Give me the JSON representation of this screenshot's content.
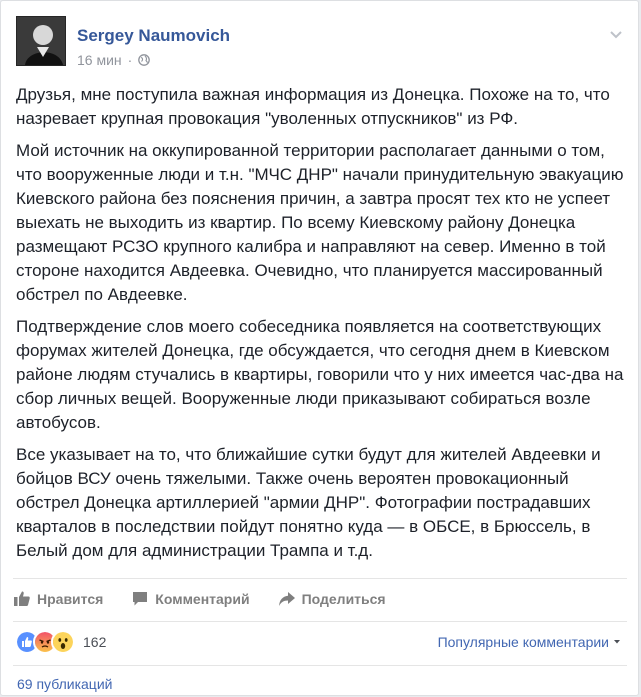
{
  "post": {
    "author": "Sergey Naumovich",
    "time": "16 мин",
    "separator": "·",
    "paragraphs": [
      "Друзья, мне поступила важная информация из Донецка. Похоже на то, что назревает крупная провокация \"уволенных отпускников\" из РФ.",
      "Мой источник на оккупированной территории располагает данными о том, что вооруженные люди и т.н. \"МЧС ДНР\" начали принудительную эвакуацию Киевского района без пояснения причин, а завтра просят тех кто не успеет выехать не выходить из квартир. По всему Киевскому району Донецка размещают РСЗО крупного калибра и направляют на север. Именно в той стороне находится Авдеевка. Очевидно, что планируется массированный обстрел по Авдеевке.",
      "Подтверждение слов моего собеседника появляется на соответствующих форумах жителей Донецка, где обсуждается, что сегодня днем в Киевском районе людям стучались в квартиры, говорили что у них имеется час-два на сбор личных вещей. Вооруженные люди приказывают собираться возле автобусов.",
      "Все указывает на то, что ближайшие сутки будут для жителей Авдеевки и бойцов ВСУ очень тяжелыми. Также очень вероятен провокационный обстрел Донецка артиллерией \"армии ДНР\". Фотографии пострадавших кварталов в последствии пойдут понятно куда — в ОБСЕ, в Брюссель, в Белый дом для администрации Трампа и т.д."
    ]
  },
  "actions": {
    "like": "Нравится",
    "comment": "Комментарий",
    "share": "Поделиться"
  },
  "reactions": {
    "count": "162",
    "icons": [
      "like-icon",
      "angry-icon",
      "wow-icon"
    ],
    "popular_comments": "Популярные комментарии"
  },
  "shares": {
    "label": "69 публикаций"
  },
  "colors": {
    "link": "#365899",
    "accent": "#4267b2",
    "muted": "#90949c"
  }
}
